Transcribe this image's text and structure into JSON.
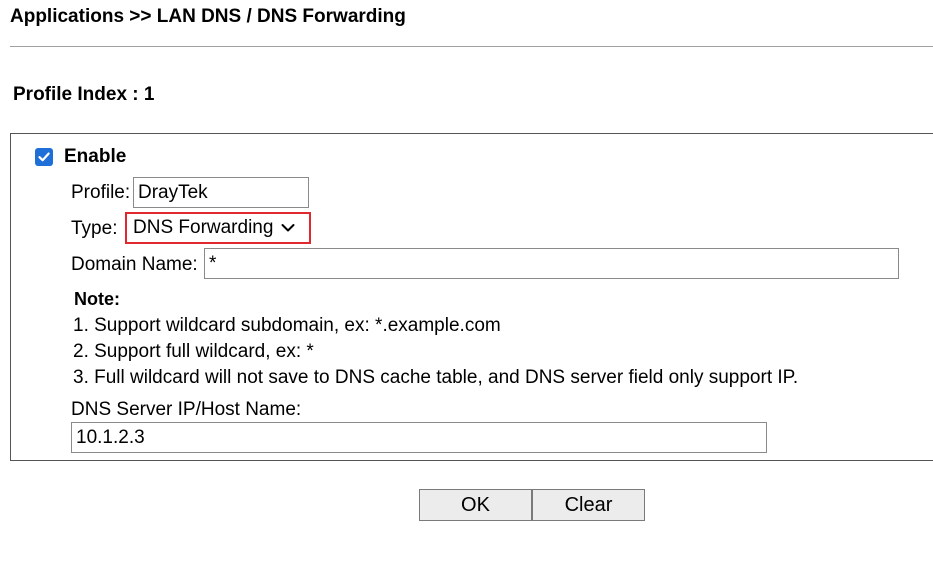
{
  "header": {
    "title": "Applications >> LAN DNS / DNS Forwarding"
  },
  "profile_index": {
    "label": "Profile Index : 1"
  },
  "form": {
    "enable": {
      "label": "Enable",
      "checked": true
    },
    "profile": {
      "label": "Profile:",
      "value": "DrayTek"
    },
    "type": {
      "label": "Type:",
      "selected": "DNS Forwarding"
    },
    "domain_name": {
      "label": "Domain Name:",
      "value": "*"
    },
    "note": {
      "title": "Note:",
      "lines": [
        "1. Support wildcard subdomain, ex: *.example.com",
        "2. Support full wildcard, ex: *",
        "3. Full wildcard will not save to DNS cache table, and DNS server field only support IP."
      ]
    },
    "dns_server": {
      "label": "DNS Server IP/Host Name:",
      "value": "10.1.2.3"
    }
  },
  "buttons": {
    "ok": "OK",
    "clear": "Clear"
  },
  "colors": {
    "checkbox": "#1f6fd9",
    "highlight_border": "#e0282e"
  }
}
